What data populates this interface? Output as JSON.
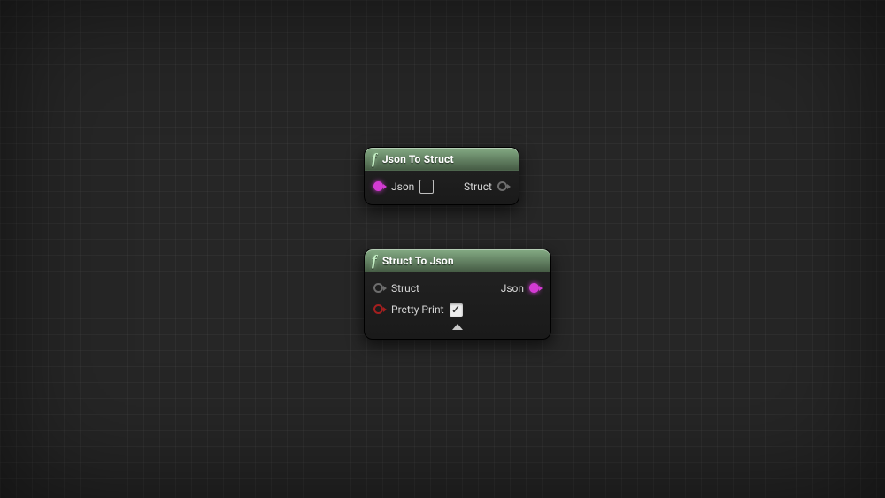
{
  "nodes": {
    "jsonToStruct": {
      "title": "Json To Struct",
      "inputs": {
        "json": "Json"
      },
      "outputs": {
        "struct": "Struct"
      }
    },
    "structToJson": {
      "title": "Struct To Json",
      "inputs": {
        "struct": "Struct",
        "prettyPrint": "Pretty Print"
      },
      "outputs": {
        "json": "Json"
      },
      "prettyPrintChecked": true
    }
  }
}
